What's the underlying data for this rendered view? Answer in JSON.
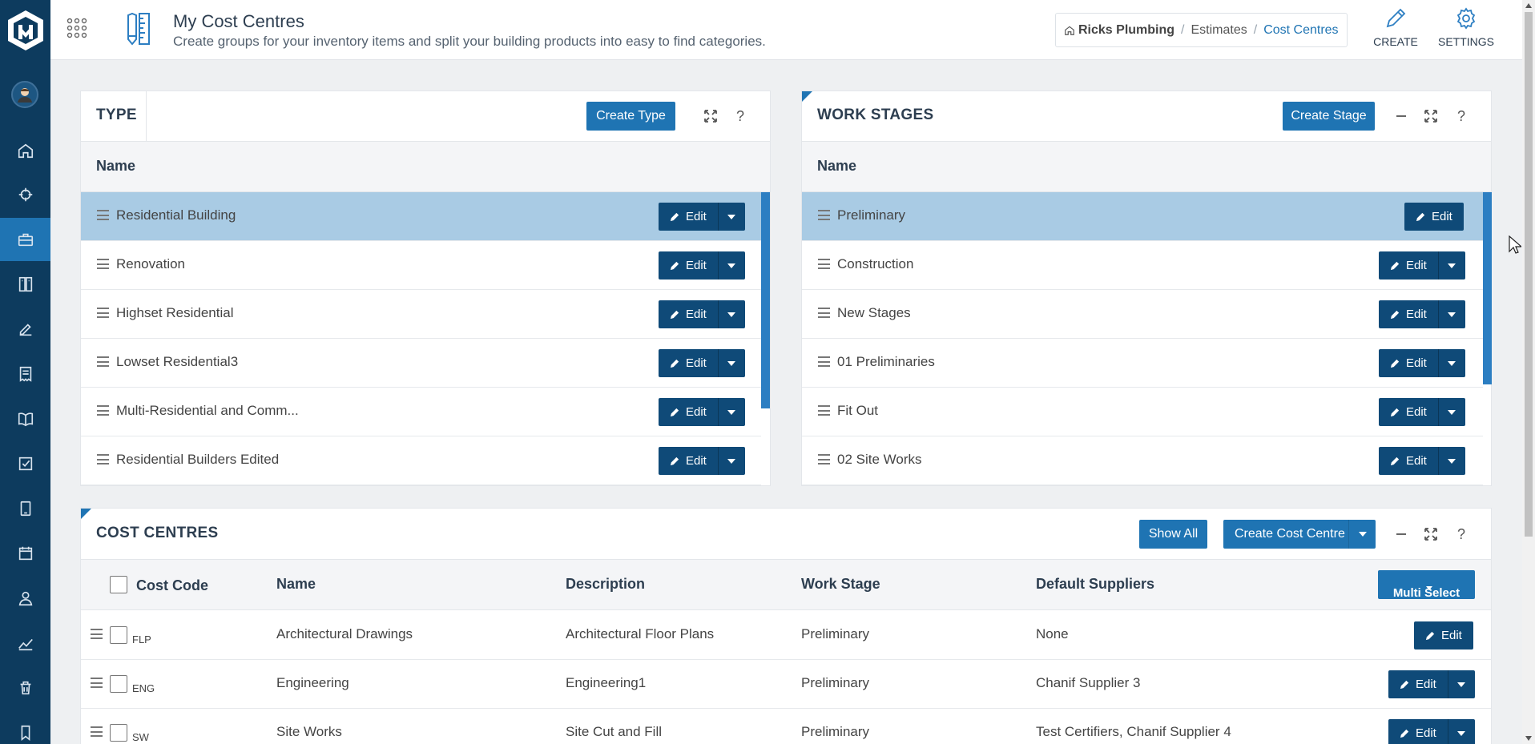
{
  "header": {
    "title": "My Cost Centres",
    "subtitle": "Create groups for your inventory items and split your building products into easy to find categories.",
    "breadcrumb": [
      "Ricks Plumbing",
      "Estimates",
      "Cost Centres"
    ],
    "create_label": "CREATE",
    "settings_label": "SETTINGS"
  },
  "sidebar": {
    "items": [
      "home-icon",
      "crosshair-icon",
      "briefcase-icon",
      "catalog-icon",
      "edit-icon",
      "receipt-icon",
      "book-icon",
      "checklist-icon",
      "tablet-icon",
      "calendar-icon",
      "user-icon",
      "chart-icon",
      "trash-icon",
      "bookmark-icon"
    ],
    "active_index": 2
  },
  "type_panel": {
    "title": "TYPE",
    "create_button": "Create Type",
    "column_header": "Name",
    "edit_label": "Edit",
    "rows": [
      "Residential Building",
      "Renovation",
      "Highset Residential",
      "Lowset Residential3",
      "Multi-Residential and Comm...",
      "Residential Builders Edited"
    ]
  },
  "stages_panel": {
    "title": "WORK STAGES",
    "create_button": "Create Stage",
    "column_header": "Name",
    "edit_label": "Edit",
    "rows": [
      "Preliminary",
      "Construction",
      "New Stages",
      "01 Preliminaries",
      "Fit Out",
      "02 Site Works"
    ]
  },
  "cost_centres": {
    "title": "COST CENTRES",
    "show_all": "Show All",
    "create_button": "Create Cost Centre",
    "multi_select": "Multi Select",
    "edit_label": "Edit",
    "columns": [
      "Cost Code",
      "Name",
      "Description",
      "Work Stage",
      "Default Suppliers"
    ],
    "rows": [
      {
        "code": "FLP",
        "name": "Architectural Drawings",
        "description": "Architectural Floor Plans",
        "stage": "Preliminary",
        "suppliers": "None"
      },
      {
        "code": "ENG",
        "name": "Engineering",
        "description": "Engineering1",
        "stage": "Preliminary",
        "suppliers": "Chanif Supplier 3"
      },
      {
        "code": "SW",
        "name": "Site Works",
        "description": "Site Cut and Fill",
        "stage": "Preliminary",
        "suppliers": "Test Certifiers, Chanif Supplier 4"
      }
    ]
  },
  "colors": {
    "sidebar": "#0d3b5e",
    "accent": "#1f74b3",
    "button_dark": "#0f4a78",
    "selected_row": "#a9cbe4"
  }
}
